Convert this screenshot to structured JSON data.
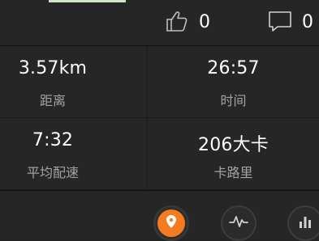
{
  "header": {
    "like_count": "0",
    "comment_count": "0"
  },
  "stats": [
    {
      "value": "3.57km",
      "label": "距离"
    },
    {
      "value": "26:57",
      "label": "时间"
    },
    {
      "value": "7:32",
      "label": "平均配速"
    },
    {
      "value": "206大卡",
      "label": "卡路里"
    }
  ],
  "icons": {
    "like": "thumbs-up-icon",
    "comment": "comment-icon",
    "map": "map-pin-icon",
    "pulse": "heart-rate-icon",
    "stats": "bar-chart-icon"
  },
  "colors": {
    "accent": "#f47b20",
    "background": "#262626",
    "label": "#a3a3a3"
  }
}
